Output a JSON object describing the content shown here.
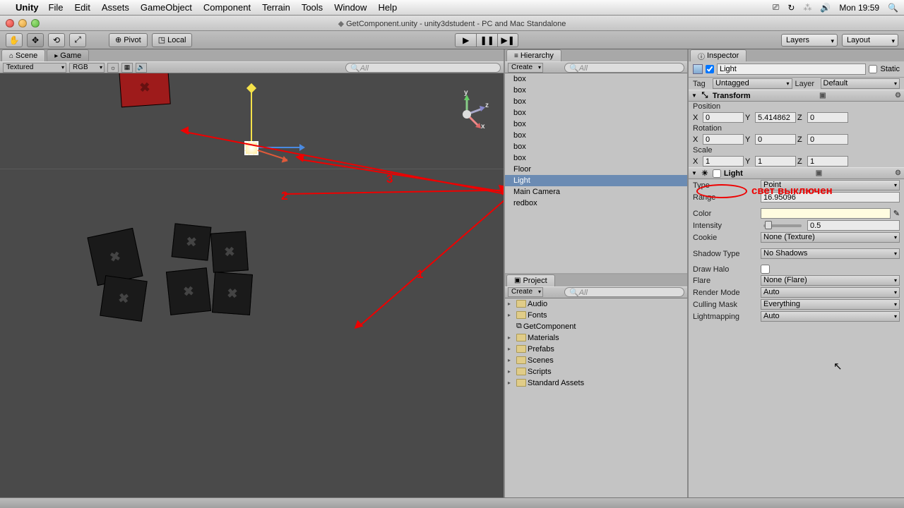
{
  "mac": {
    "app": "Unity",
    "menus": [
      "File",
      "Edit",
      "Assets",
      "GameObject",
      "Component",
      "Terrain",
      "Tools",
      "Window",
      "Help"
    ],
    "clock": "Mon 19:59"
  },
  "window_title": "GetComponent.unity - unity3dstudent - PC and Mac Standalone",
  "toolbar": {
    "pivot": "Pivot",
    "local": "Local",
    "layers": "Layers",
    "layout": "Layout"
  },
  "scene": {
    "tab_scene": "Scene",
    "tab_game": "Game",
    "shading": "Textured",
    "render": "RGB",
    "search_ph": "All"
  },
  "hierarchy": {
    "tab": "Hierarchy",
    "create": "Create",
    "search_ph": "All",
    "items": [
      "box",
      "box",
      "box",
      "box",
      "box",
      "box",
      "box",
      "box",
      "Floor",
      "Light",
      "Main Camera",
      "redbox"
    ],
    "selected_index": 9
  },
  "project": {
    "tab": "Project",
    "create": "Create",
    "search_ph": "All",
    "items": [
      {
        "name": "Audio",
        "type": "folder",
        "expand": true
      },
      {
        "name": "Fonts",
        "type": "folder",
        "expand": true
      },
      {
        "name": "GetComponent",
        "type": "script",
        "expand": false
      },
      {
        "name": "Materials",
        "type": "folder",
        "expand": true
      },
      {
        "name": "Prefabs",
        "type": "folder",
        "expand": true
      },
      {
        "name": "Scenes",
        "type": "folder",
        "expand": true
      },
      {
        "name": "Scripts",
        "type": "folder",
        "expand": true
      },
      {
        "name": "Standard Assets",
        "type": "folder",
        "expand": true
      }
    ]
  },
  "inspector": {
    "tab": "Inspector",
    "name": "Light",
    "static": "Static",
    "tag_label": "Tag",
    "tag": "Untagged",
    "layer_label": "Layer",
    "layer": "Default",
    "transform": {
      "title": "Transform",
      "position_label": "Position",
      "rotation_label": "Rotation",
      "scale_label": "Scale",
      "pos": {
        "x": "0",
        "y": "5.414862",
        "z": "0"
      },
      "rot": {
        "x": "0",
        "y": "0",
        "z": "0"
      },
      "scale": {
        "x": "1",
        "y": "1",
        "z": "1"
      }
    },
    "light": {
      "title": "Light",
      "type_label": "Type",
      "type": "Point",
      "range_label": "Range",
      "range": "16.95096",
      "color_label": "Color",
      "color": "#fffce0",
      "intensity_label": "Intensity",
      "intensity": "0.5",
      "cookie_label": "Cookie",
      "cookie": "None (Texture)",
      "shadow_label": "Shadow Type",
      "shadow": "No Shadows",
      "halo_label": "Draw Halo",
      "flare_label": "Flare",
      "flare": "None (Flare)",
      "render_label": "Render Mode",
      "render": "Auto",
      "culling_label": "Culling Mask",
      "culling": "Everything",
      "lightmap_label": "Lightmapping",
      "lightmap": "Auto"
    }
  },
  "annotations": {
    "light_off": "свет выключен",
    "n1": "1",
    "n2": "2",
    "n3": "3"
  }
}
